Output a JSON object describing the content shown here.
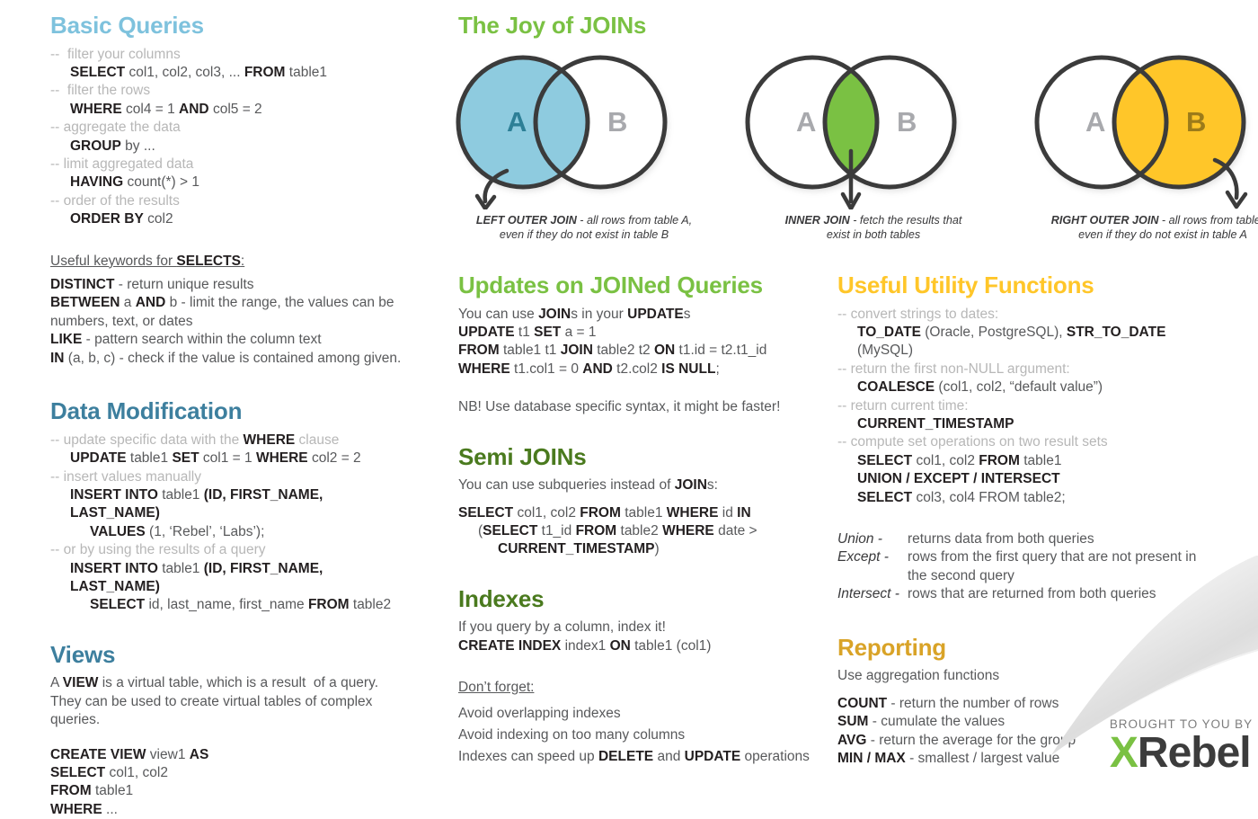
{
  "colors": {
    "light_blue": "#7ec2dd",
    "steel_blue": "#3d7f9e",
    "green": "#7ac143",
    "dark_green": "#4a7a1e",
    "yellow": "#ffc629",
    "gold": "#d9a327",
    "comment_gray": "#b7b7b7",
    "body_gray": "#58595b",
    "keyword_black": "#231f20",
    "venn_stroke": "#3b3b3b"
  },
  "basic_queries": {
    "title": "Basic Queries",
    "lines": [
      {
        "indent": 0,
        "parts": [
          {
            "t": "-- ",
            "s": "cmt"
          },
          {
            "t": " filter your columns",
            "s": "cmt"
          }
        ]
      },
      {
        "indent": 1,
        "parts": [
          {
            "t": "SELECT",
            "s": "kw"
          },
          {
            "t": " col1, col2, col3, ... ",
            "s": "tx"
          },
          {
            "t": "FROM",
            "s": "kw"
          },
          {
            "t": " table1",
            "s": "tx"
          }
        ]
      },
      {
        "indent": 0,
        "parts": [
          {
            "t": "--  filter the rows",
            "s": "cmt"
          }
        ]
      },
      {
        "indent": 1,
        "parts": [
          {
            "t": "WHERE",
            "s": "kw"
          },
          {
            "t": " col4 = 1 ",
            "s": "tx"
          },
          {
            "t": "AND",
            "s": "kw"
          },
          {
            "t": " col5 = 2",
            "s": "tx"
          }
        ]
      },
      {
        "indent": 0,
        "parts": [
          {
            "t": "-- aggregate the data",
            "s": "cmt"
          }
        ]
      },
      {
        "indent": 1,
        "parts": [
          {
            "t": "GROUP",
            "s": "kw"
          },
          {
            "t": " by ...",
            "s": "tx"
          }
        ]
      },
      {
        "indent": 0,
        "parts": [
          {
            "t": "-- limit aggregated data",
            "s": "cmt"
          }
        ]
      },
      {
        "indent": 1,
        "parts": [
          {
            "t": "HAVING",
            "s": "kw"
          },
          {
            "t": " count(*) > 1",
            "s": "tx"
          }
        ]
      },
      {
        "indent": 0,
        "parts": [
          {
            "t": "-- order of the results",
            "s": "cmt"
          }
        ]
      },
      {
        "indent": 1,
        "parts": [
          {
            "t": "ORDER BY",
            "s": "kw"
          },
          {
            "t": " col2",
            "s": "tx"
          }
        ]
      }
    ],
    "keywords_heading": [
      {
        "t": "Useful keywords for ",
        "s": "tx"
      },
      {
        "t": "SELECTS",
        "s": "kw"
      },
      {
        "t": ":",
        "s": "tx"
      }
    ],
    "keywords": [
      {
        "indent": 0,
        "parts": [
          {
            "t": "DISTINCT",
            "s": "kw"
          },
          {
            "t": " - return unique results",
            "s": "tx"
          }
        ]
      },
      {
        "indent": 0,
        "parts": [
          {
            "t": "BETWEEN",
            "s": "kw"
          },
          {
            "t": " a ",
            "s": "tx"
          },
          {
            "t": "AND",
            "s": "kw"
          },
          {
            "t": " b - limit the range, the values can be numbers, text, or dates",
            "s": "tx"
          }
        ]
      },
      {
        "indent": 0,
        "parts": [
          {
            "t": "LIKE",
            "s": "kw"
          },
          {
            "t": " - pattern search within the column text",
            "s": "tx"
          }
        ]
      },
      {
        "indent": 0,
        "parts": [
          {
            "t": "IN",
            "s": "kw"
          },
          {
            "t": " (a, b, c) - check if the value is contained among given.",
            "s": "tx"
          }
        ]
      }
    ]
  },
  "data_modification": {
    "title": "Data Modification",
    "lines": [
      {
        "indent": 0,
        "parts": [
          {
            "t": "-- update specific data with the ",
            "s": "cmt"
          },
          {
            "t": "WHERE",
            "s": "kw"
          },
          {
            "t": " clause",
            "s": "cmt"
          }
        ]
      },
      {
        "indent": 1,
        "parts": [
          {
            "t": "UPDATE",
            "s": "kw"
          },
          {
            "t": " table1 ",
            "s": "tx"
          },
          {
            "t": "SET",
            "s": "kw"
          },
          {
            "t": " col1 = 1 ",
            "s": "tx"
          },
          {
            "t": "WHERE",
            "s": "kw"
          },
          {
            "t": " col2 = 2",
            "s": "tx"
          }
        ]
      },
      {
        "indent": 0,
        "parts": [
          {
            "t": "-- insert values manually",
            "s": "cmt"
          }
        ]
      },
      {
        "indent": 1,
        "parts": [
          {
            "t": "INSERT INTO",
            "s": "kw"
          },
          {
            "t": " table1 ",
            "s": "tx"
          },
          {
            "t": "(ID, FIRST_NAME, LAST_NAME)",
            "s": "kw"
          }
        ]
      },
      {
        "indent": 2,
        "parts": [
          {
            "t": "VALUES",
            "s": "kw"
          },
          {
            "t": " (1, ‘Rebel’, ‘Labs’);",
            "s": "tx"
          }
        ]
      },
      {
        "indent": 0,
        "parts": [
          {
            "t": "-- or by using the results of a query",
            "s": "cmt"
          }
        ]
      },
      {
        "indent": 1,
        "parts": [
          {
            "t": "INSERT INTO",
            "s": "kw"
          },
          {
            "t": " table1 ",
            "s": "tx"
          },
          {
            "t": "(ID, FIRST_NAME, LAST_NAME)",
            "s": "kw"
          }
        ]
      },
      {
        "indent": 2,
        "parts": [
          {
            "t": "SELECT",
            "s": "kw"
          },
          {
            "t": " id, last_name, first_name ",
            "s": "tx"
          },
          {
            "t": "FROM",
            "s": "kw"
          },
          {
            "t": " table2",
            "s": "tx"
          }
        ]
      }
    ]
  },
  "views": {
    "title": "Views",
    "intro": [
      {
        "indent": 0,
        "parts": [
          {
            "t": "A ",
            "s": "tx"
          },
          {
            "t": "VIEW",
            "s": "kw"
          },
          {
            "t": " is a virtual table, which is a result  of a query.",
            "s": "tx"
          }
        ]
      },
      {
        "indent": 0,
        "parts": [
          {
            "t": "They can be used to create virtual tables of complex queries.",
            "s": "tx"
          }
        ]
      }
    ],
    "code": [
      {
        "indent": 0,
        "parts": [
          {
            "t": "CREATE VIEW",
            "s": "kw"
          },
          {
            "t": " view1 ",
            "s": "tx"
          },
          {
            "t": "AS",
            "s": "kw"
          }
        ]
      },
      {
        "indent": 0,
        "parts": [
          {
            "t": "SELECT",
            "s": "kw"
          },
          {
            "t": " col1, col2",
            "s": "tx"
          }
        ]
      },
      {
        "indent": 0,
        "parts": [
          {
            "t": "FROM",
            "s": "kw"
          },
          {
            "t": " table1",
            "s": "tx"
          }
        ]
      },
      {
        "indent": 0,
        "parts": [
          {
            "t": "WHERE",
            "s": "kw"
          },
          {
            "t": " ...",
            "s": "tx"
          }
        ]
      }
    ]
  },
  "joins": {
    "title": "The Joy of JOINs",
    "diagrams": [
      {
        "id": "left-outer-join",
        "fill": "left",
        "color": "#8ecbdf",
        "label_a": "A",
        "label_b": "B",
        "label_a_color": "#2d7f96",
        "label_b_color": "#a8a9ad",
        "caption_bold": "LEFT OUTER JOIN",
        "caption_rest": " - all rows from table A,",
        "caption_line2": "even if they do not exist in table B"
      },
      {
        "id": "inner-join",
        "fill": "intersection",
        "color": "#7ac143",
        "label_a": "A",
        "label_b": "B",
        "label_a_color": "#a8a9ad",
        "label_b_color": "#a8a9ad",
        "caption_bold": "INNER JOIN",
        "caption_rest": " - fetch the results that",
        "caption_line2": "exist in both tables"
      },
      {
        "id": "right-outer-join",
        "fill": "right",
        "color": "#ffc629",
        "label_a": "A",
        "label_b": "B",
        "label_a_color": "#a8a9ad",
        "label_b_color": "#9c7b1a",
        "caption_bold": "RIGHT OUTER JOIN",
        "caption_rest": " - all rows from table B,",
        "caption_line2": "even if they do not exist in table A"
      }
    ]
  },
  "updates_joined": {
    "title": "Updates on JOINed Queries",
    "lines": [
      {
        "indent": 0,
        "parts": [
          {
            "t": "You can use ",
            "s": "tx"
          },
          {
            "t": "JOIN",
            "s": "kw"
          },
          {
            "t": "s in your ",
            "s": "tx"
          },
          {
            "t": "UPDATE",
            "s": "kw"
          },
          {
            "t": "s",
            "s": "tx"
          }
        ]
      },
      {
        "indent": 0,
        "parts": [
          {
            "t": "UPDATE",
            "s": "kw"
          },
          {
            "t": " t1 ",
            "s": "tx"
          },
          {
            "t": "SET",
            "s": "kw"
          },
          {
            "t": " a = 1",
            "s": "tx"
          }
        ]
      },
      {
        "indent": 0,
        "parts": [
          {
            "t": "FROM",
            "s": "kw"
          },
          {
            "t": " table1 t1 ",
            "s": "tx"
          },
          {
            "t": "JOIN",
            "s": "kw"
          },
          {
            "t": " table2 t2 ",
            "s": "tx"
          },
          {
            "t": "ON",
            "s": "kw"
          },
          {
            "t": " t1.id = t2.t1_id",
            "s": "tx"
          }
        ]
      },
      {
        "indent": 0,
        "parts": [
          {
            "t": "WHERE",
            "s": "kw"
          },
          {
            "t": " t1.col1 = 0 ",
            "s": "tx"
          },
          {
            "t": "AND",
            "s": "kw"
          },
          {
            "t": " t2.col2 ",
            "s": "tx"
          },
          {
            "t": "IS NULL",
            "s": "kw"
          },
          {
            "t": ";",
            "s": "tx"
          }
        ]
      }
    ],
    "note": "NB! Use database specific syntax, it might be faster!"
  },
  "semi_joins": {
    "title": "Semi JOINs",
    "intro": [
      {
        "t": "You can use subqueries instead of ",
        "s": "tx"
      },
      {
        "t": "JOIN",
        "s": "kw"
      },
      {
        "t": "s:",
        "s": "tx"
      }
    ],
    "lines": [
      {
        "indent": 0,
        "parts": [
          {
            "t": "SELECT",
            "s": "kw"
          },
          {
            "t": " col1, col2 ",
            "s": "tx"
          },
          {
            "t": "FROM",
            "s": "kw"
          },
          {
            "t": " table1 ",
            "s": "tx"
          },
          {
            "t": "WHERE",
            "s": "kw"
          },
          {
            "t": " id ",
            "s": "tx"
          },
          {
            "t": "IN",
            "s": "kw"
          }
        ]
      },
      {
        "indent": 1,
        "parts": [
          {
            "t": "(",
            "s": "tx"
          },
          {
            "t": "SELECT",
            "s": "kw"
          },
          {
            "t": " t1_id ",
            "s": "tx"
          },
          {
            "t": "FROM",
            "s": "kw"
          },
          {
            "t": " table2 ",
            "s": "tx"
          },
          {
            "t": "WHERE",
            "s": "kw"
          },
          {
            "t": " date >",
            "s": "tx"
          }
        ]
      },
      {
        "indent": 2,
        "parts": [
          {
            "t": "CURRENT_TIMESTAMP",
            "s": "kw"
          },
          {
            "t": ")",
            "s": "tx"
          }
        ]
      }
    ]
  },
  "indexes": {
    "title": "Indexes",
    "lines": [
      {
        "indent": 0,
        "parts": [
          {
            "t": "If you query by a column, index it!",
            "s": "tx"
          }
        ]
      },
      {
        "indent": 0,
        "parts": [
          {
            "t": "CREATE INDEX",
            "s": "kw"
          },
          {
            "t": " index1 ",
            "s": "tx"
          },
          {
            "t": "ON",
            "s": "kw"
          },
          {
            "t": " table1 (col1)",
            "s": "tx"
          }
        ]
      }
    ],
    "dont_forget_heading": "Don’t forget:",
    "dont_forget": [
      {
        "indent": 0,
        "parts": [
          {
            "t": "Avoid overlapping indexes",
            "s": "tx"
          }
        ]
      },
      {
        "indent": 0,
        "parts": [
          {
            "t": "Avoid indexing on too many columns",
            "s": "tx"
          }
        ]
      },
      {
        "indent": 0,
        "parts": [
          {
            "t": "Indexes can speed up ",
            "s": "tx"
          },
          {
            "t": "DELETE",
            "s": "kw"
          },
          {
            "t": " and ",
            "s": "tx"
          },
          {
            "t": "UPDATE",
            "s": "kw"
          },
          {
            "t": " operations",
            "s": "tx"
          }
        ]
      }
    ]
  },
  "utility_functions": {
    "title": "Useful Utility Functions",
    "lines": [
      {
        "indent": 0,
        "parts": [
          {
            "t": "-- convert strings to dates:",
            "s": "cmt"
          }
        ]
      },
      {
        "indent": 1,
        "parts": [
          {
            "t": "TO_DATE",
            "s": "kw"
          },
          {
            "t": " (Oracle, PostgreSQL), ",
            "s": "tx"
          },
          {
            "t": "STR_TO_DATE",
            "s": "kw"
          },
          {
            "t": " (MySQL)",
            "s": "tx"
          }
        ]
      },
      {
        "indent": 0,
        "parts": [
          {
            "t": "-- return the first non-NULL argument:",
            "s": "cmt"
          }
        ]
      },
      {
        "indent": 1,
        "parts": [
          {
            "t": "COALESCE",
            "s": "kw"
          },
          {
            "t": " (col1, col2, “default value”)",
            "s": "tx"
          }
        ]
      },
      {
        "indent": 0,
        "parts": [
          {
            "t": "-- return current time:",
            "s": "cmt"
          }
        ]
      },
      {
        "indent": 1,
        "parts": [
          {
            "t": "CURRENT_TIMESTAMP",
            "s": "kw"
          }
        ]
      },
      {
        "indent": 0,
        "parts": [
          {
            "t": "-- compute set operations on two result sets",
            "s": "cmt"
          }
        ]
      },
      {
        "indent": 1,
        "parts": [
          {
            "t": "SELECT",
            "s": "kw"
          },
          {
            "t": " col1, col2 ",
            "s": "tx"
          },
          {
            "t": "FROM",
            "s": "kw"
          },
          {
            "t": " table1",
            "s": "tx"
          }
        ]
      },
      {
        "indent": 1,
        "parts": [
          {
            "t": "UNION / EXCEPT / INTERSECT",
            "s": "kw"
          }
        ]
      },
      {
        "indent": 1,
        "parts": [
          {
            "t": "SELECT",
            "s": "kw"
          },
          {
            "t": " col3, col4 FROM table2;",
            "s": "tx"
          }
        ]
      }
    ],
    "definitions": [
      {
        "term": "Union -",
        "desc": "returns data from both queries"
      },
      {
        "term": "Except -",
        "desc": "rows from the first query that are not present in the second query"
      },
      {
        "term": "Intersect -",
        "desc": "rows that are returned from both queries"
      }
    ]
  },
  "reporting": {
    "title": "Reporting",
    "intro": "Use aggregation functions",
    "lines": [
      {
        "indent": 0,
        "parts": [
          {
            "t": "COUNT",
            "s": "kw"
          },
          {
            "t": " - return the number of rows",
            "s": "tx"
          }
        ]
      },
      {
        "indent": 0,
        "parts": [
          {
            "t": "SUM",
            "s": "kw"
          },
          {
            "t": " - cumulate the values",
            "s": "tx"
          }
        ]
      },
      {
        "indent": 0,
        "parts": [
          {
            "t": "AVG",
            "s": "kw"
          },
          {
            "t": " - return the average for the group",
            "s": "tx"
          }
        ]
      },
      {
        "indent": 0,
        "parts": [
          {
            "t": "MIN / MAX",
            "s": "kw"
          },
          {
            "t": " - smallest / largest value",
            "s": "tx"
          }
        ]
      }
    ]
  },
  "branding": {
    "tagline": "BROUGHT TO YOU BY",
    "logo_x": "X",
    "logo_rebel": "Rebel"
  }
}
